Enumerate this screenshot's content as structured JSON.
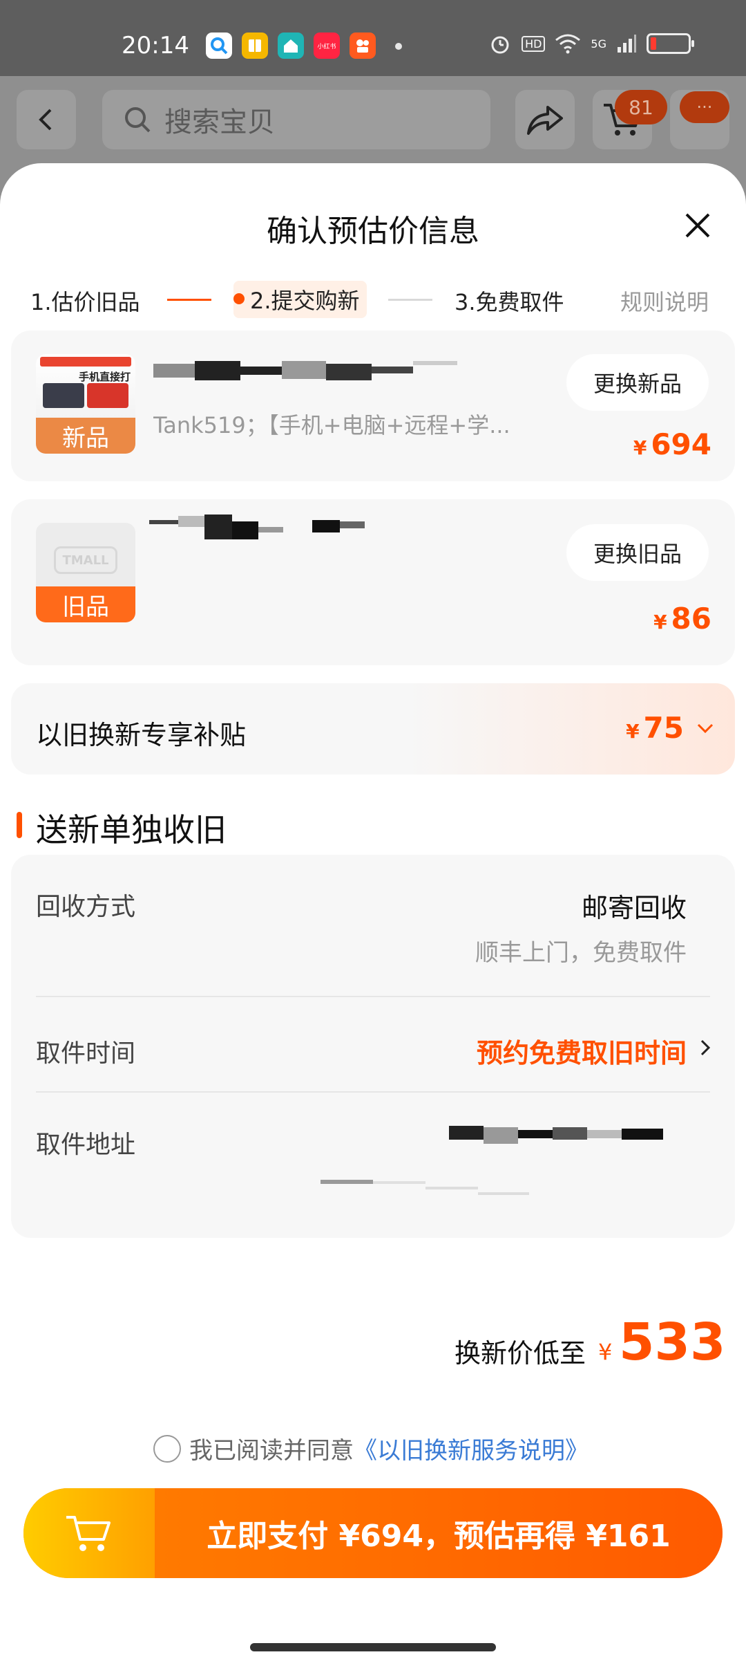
{
  "status_bar": {
    "time": "20:14",
    "apps": [
      {
        "icon": "search-app-icon",
        "color": "#2196f3"
      },
      {
        "icon": "book-app-icon",
        "color": "#f5b700"
      },
      {
        "icon": "home-app-icon",
        "color": "#1fb5b5"
      },
      {
        "icon": "xiaohongshu-app-icon",
        "color": "#ff2442",
        "text": "小红书"
      },
      {
        "icon": "kuaishou-app-icon",
        "color": "#ff5a1f"
      }
    ],
    "right": {
      "hd": "HD",
      "network": "5G",
      "battery_level": 0.12
    }
  },
  "top_nav": {
    "search_placeholder": "搜索宝贝",
    "cart_count": "81",
    "more_label": "···"
  },
  "sheet": {
    "title": "确认预估价信息",
    "steps": [
      {
        "label": "1.估价旧品"
      },
      {
        "label": "2.提交购新",
        "active": true
      },
      {
        "label": "3.免费取件"
      }
    ],
    "rules_label": "规则说明",
    "new_item": {
      "badge": "新品",
      "description": "Tank519；【手机+电脑+远程+学...",
      "swap_label": "更换新品",
      "currency": "¥",
      "price": "694",
      "thumb_text": "手机直接打"
    },
    "old_item": {
      "badge": "旧品",
      "swap_label": "更换旧品",
      "currency": "¥",
      "price": "86",
      "thumb_text": "TMALL"
    },
    "subsidy": {
      "label": "以旧换新专享补贴",
      "currency": "¥",
      "price": "75"
    },
    "section_title": "送新单独收旧",
    "recycle": {
      "method_label": "回收方式",
      "method_value": "邮寄回收",
      "method_sub": "顺丰上门，免费取件",
      "time_label": "取件时间",
      "time_value": "预约免费取旧时间",
      "address_label": "取件地址"
    },
    "final": {
      "label": "换新价低至",
      "currency": "¥",
      "price": "533"
    },
    "agreement": {
      "text": "我已阅读并同意",
      "link": "《以旧换新服务说明》"
    },
    "pay_button": "立即支付 ¥694，预估再得 ¥161"
  },
  "colors": {
    "accent": "#ff5000",
    "link": "#3a7bd5"
  }
}
